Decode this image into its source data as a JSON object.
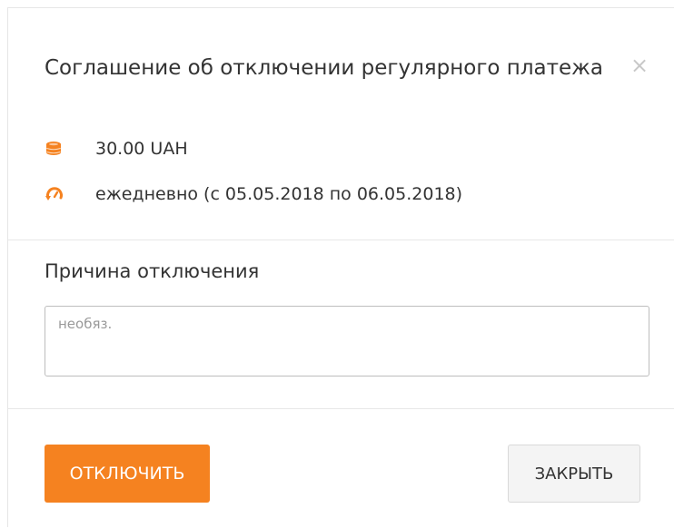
{
  "modal": {
    "title": "Соглашение об отключении регулярного платежа",
    "close_glyph": "×",
    "amount": "30.00 UAH",
    "amount_icon": "coins-icon",
    "schedule": "ежедневно (с 05.05.2018 по 06.05.2018)",
    "schedule_icon": "recurring-icon",
    "accent_color": "#f58220"
  },
  "reason": {
    "label": "Причина отключения",
    "placeholder": "необяз.",
    "value": ""
  },
  "footer": {
    "disable_label": "ОТКЛЮЧИТЬ",
    "close_label": "ЗАКРЫТЬ"
  }
}
